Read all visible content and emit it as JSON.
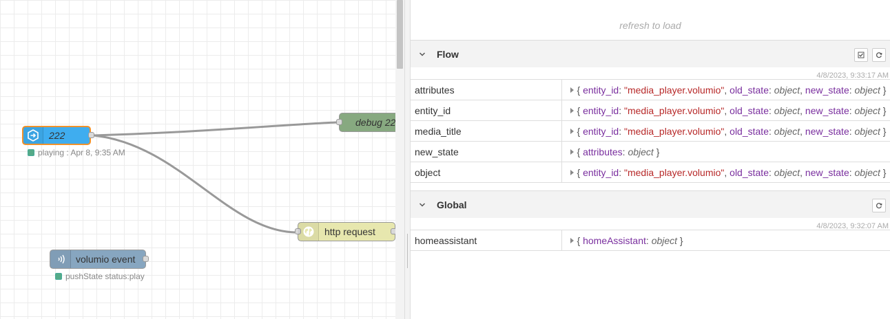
{
  "workspace": {
    "nodes": {
      "inject": {
        "label": "222",
        "status": "playing : Apr 8, 9:35 AM",
        "color": "#3fadef"
      },
      "debug": {
        "label": "debug 22",
        "color": "#87a980"
      },
      "http": {
        "label": "http request",
        "color": "#e7e7ae"
      },
      "volumio": {
        "label": "volumio event",
        "status": "pushState status:play",
        "color": "#87a6c0"
      }
    }
  },
  "sidebar": {
    "refresh_text": "refresh to load",
    "flow": {
      "title": "Flow",
      "timestamp": "4/8/2023, 9:33:17 AM",
      "rows": [
        {
          "key": "attributes",
          "entity_key": "entity_id",
          "entity_val": "\"media_player.volumio\"",
          "old_key": "old_state",
          "new_key": "new_state",
          "obj": "object"
        },
        {
          "key": "entity_id",
          "entity_key": "entity_id",
          "entity_val": "\"media_player.volumio\"",
          "old_key": "old_state",
          "new_key": "new_state",
          "obj": "object"
        },
        {
          "key": "media_title",
          "entity_key": "entity_id",
          "entity_val": "\"media_player.volumio\"",
          "old_key": "old_state",
          "new_key": "new_state",
          "obj": "object"
        },
        {
          "key": "new_state",
          "attr_key": "attributes",
          "obj": "object"
        },
        {
          "key": "object",
          "entity_key": "entity_id",
          "entity_val": "\"media_player.volumio\"",
          "old_key": "old_state",
          "new_key": "new_state",
          "obj": "object"
        }
      ]
    },
    "global": {
      "title": "Global",
      "timestamp": "4/8/2023, 9:32:07 AM",
      "rows": [
        {
          "key": "homeassistant",
          "ha_key": "homeAssistant",
          "obj": "object"
        }
      ]
    }
  }
}
